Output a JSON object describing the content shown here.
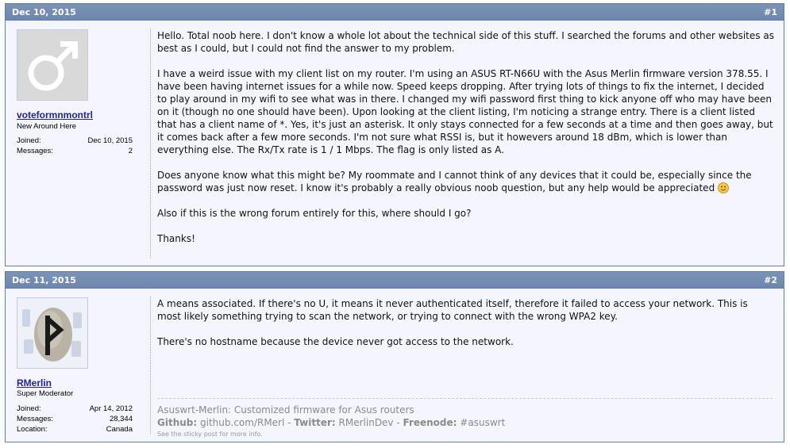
{
  "posts": [
    {
      "date": "Dec 10, 2015",
      "number": "#1",
      "user": {
        "name": "voteformnmontrl",
        "title": "New Around Here",
        "stats": [
          {
            "label": "Joined:",
            "value": "Dec 10, 2015"
          },
          {
            "label": "Messages:",
            "value": "2"
          }
        ]
      },
      "paragraphs": [
        "Hello. Total noob here. I don't know a whole lot about the technical side of this stuff. I searched the forums and other websites as best as I could, but I could not find the answer to my problem.",
        "I have a weird issue with my client list on my router. I'm using an ASUS RT-N66U with the Asus Merlin firmware version 378.55. I have been having internet issues for a while now. Speed keeps dropping. After trying lots of things to fix the internet, I decided to play around in my wifi to see what was in there. I changed my wifi password first thing to kick anyone off who may have been on it (though no one should have been). Upon looking at the client listing, I'm noticing a strange entry. There is a client listed that has a client name of *. Yes, it's just an asterisk. It only stays connected for a few seconds at a time and then goes away, but it comes back after a few more seconds. I'm not sure what RSSI is, but it howevers around 18 dBm, which is lower than everything else. The Rx/Tx rate is 1 / 1 Mbps. The flag is only listed as A.",
        "Does anyone know what this might be? My roommate and I cannot think of any devices that it could be, especially since the password was just now reset. I know it's probably a really obvious noob question, but any help would be appreciated",
        "Also if this is the wrong forum entirely for this, where should I go?",
        "Thanks!"
      ]
    },
    {
      "date": "Dec 11, 2015",
      "number": "#2",
      "user": {
        "name": "RMerlin",
        "title": "Super Moderator",
        "stats": [
          {
            "label": "Joined:",
            "value": "Apr 14, 2012"
          },
          {
            "label": "Messages:",
            "value": "28,344"
          },
          {
            "label": "Location:",
            "value": "Canada"
          }
        ]
      },
      "paragraphs": [
        "A means associated. If there's no U, it means it never authenticated itself, therefore it failed to access your network. This is most likely something trying to scan the network, or trying to connect with the wrong WPA2 key.",
        "There's no hostname because the device never got access to the network."
      ],
      "signature": {
        "line1": "Asuswrt-Merlin: Customized firmware for Asus routers",
        "github_label": "Github:",
        "github_value": "github.com/RMerl",
        "sep1": " - ",
        "twitter_label": "Twitter:",
        "twitter_value": "RMerlinDev",
        "sep2": " - ",
        "freenode_label": "Freenode:",
        "freenode_value": "#asuswrt",
        "note": "See the sticky post for more info."
      }
    }
  ],
  "colors": {
    "header": "#6b86ae",
    "border": "#5f7fa7",
    "username": "#22229c",
    "background": "#f5f5ff"
  }
}
